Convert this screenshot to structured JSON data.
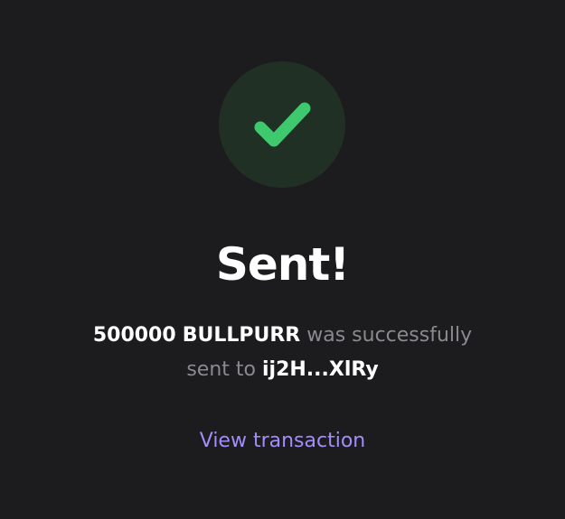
{
  "icon": {
    "name": "checkmark-icon",
    "circle_color": "#213024",
    "check_color": "#3ec96f"
  },
  "title": "Sent!",
  "message": {
    "amount": "500000",
    "token": "BULLPURR",
    "text_middle": "was successfully",
    "text_sent_to": "sent to",
    "recipient": "ij2H...XlRy"
  },
  "link": {
    "label": "View transaction",
    "color": "#a28dfa"
  }
}
